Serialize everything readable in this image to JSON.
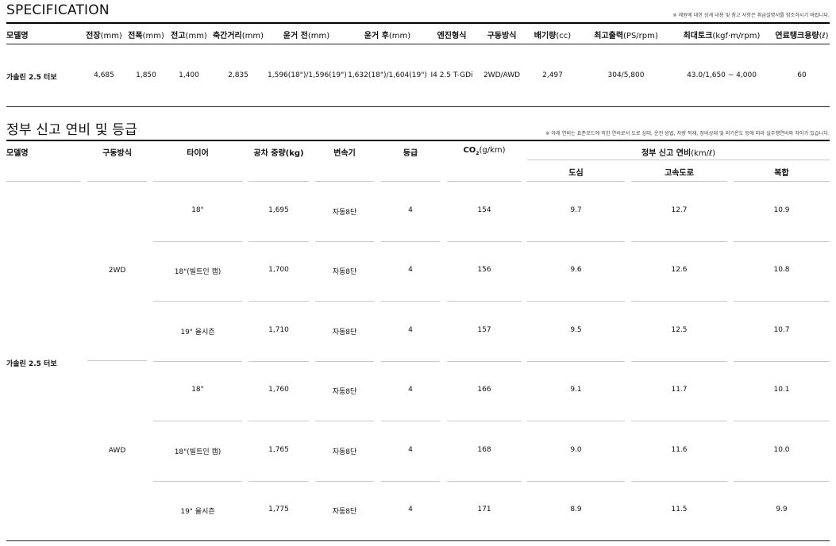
{
  "spec": {
    "title": "SPECIFICATION",
    "note": "※ 제원에 대한 상세 내용 및 참고 사항은 취급설명서를 참조하시기 바랍니다.",
    "headers": [
      {
        "label": "모델명",
        "unit": ""
      },
      {
        "label": "전장",
        "unit": "(mm)"
      },
      {
        "label": "전폭",
        "unit": "(mm)"
      },
      {
        "label": "전고",
        "unit": "(mm)"
      },
      {
        "label": "축간거리",
        "unit": "(mm)"
      },
      {
        "label": "윤거 전",
        "unit": "(mm)"
      },
      {
        "label": "윤거 후",
        "unit": "(mm)"
      },
      {
        "label": "엔진형식",
        "unit": ""
      },
      {
        "label": "구동방식",
        "unit": ""
      },
      {
        "label": "배기량",
        "unit": "(cc)"
      },
      {
        "label": "최고출력",
        "unit": "(PS/rpm)"
      },
      {
        "label": "최대토크",
        "unit": "(kgf·m/rpm)"
      },
      {
        "label": "연료탱크용량",
        "unit": "(ℓ)"
      }
    ],
    "row": [
      "가솔린 2.5 터보",
      "4,685",
      "1,850",
      "1,400",
      "2,835",
      "1,596(18\")/1,596(19\")",
      "1,632(18\")/1,604(19\")",
      "I4 2.5 T-GDi",
      "2WD/AWD",
      "2,497",
      "304/5,800",
      "43.0/1,650 ~ 4,000",
      "60"
    ]
  },
  "fuel": {
    "title": "정부 신고 연비 및 등급",
    "note": "※ 아래 연비는 표준모드에 의한 연비로서 도로 상태, 운전 방법, 차량 적재, 정비상태 및 외기온도 등에 따라 실주행연비와 차이가 있습니다.",
    "headers": {
      "model": "모델명",
      "drive": "구동방식",
      "tire": "타이어",
      "weight": "공차 중량(kg)",
      "trans": "변속기",
      "grade": "등급",
      "co2_main": "CO",
      "co2_sub": "2",
      "co2_unit": "(g/km)",
      "eff_main": "정부 신고 연비",
      "eff_unit": "(km/ℓ)",
      "city": "도심",
      "highway": "고속도로",
      "combined": "복합"
    },
    "model": "가솔린 2.5 터보",
    "groups": [
      "2WD",
      "AWD"
    ],
    "rows": [
      {
        "tire": "18\"",
        "weight": "1,695",
        "trans": "자동8단",
        "grade": "4",
        "co2": "154",
        "city": "9.7",
        "highway": "12.7",
        "combined": "10.9"
      },
      {
        "tire": "18\"(빌트인 캠)",
        "weight": "1,700",
        "trans": "자동8단",
        "grade": "4",
        "co2": "156",
        "city": "9.6",
        "highway": "12.6",
        "combined": "10.8"
      },
      {
        "tire": "19\" 올시즌",
        "weight": "1,710",
        "trans": "자동8단",
        "grade": "4",
        "co2": "157",
        "city": "9.5",
        "highway": "12.5",
        "combined": "10.7"
      },
      {
        "tire": "18\"",
        "weight": "1,760",
        "trans": "자동8단",
        "grade": "4",
        "co2": "166",
        "city": "9.1",
        "highway": "11.7",
        "combined": "10.1"
      },
      {
        "tire": "18\"(빌트인 캠)",
        "weight": "1,765",
        "trans": "자동8단",
        "grade": "4",
        "co2": "168",
        "city": "9.0",
        "highway": "11.6",
        "combined": "10.0"
      },
      {
        "tire": "19\" 올시즌",
        "weight": "1,775",
        "trans": "자동8단",
        "grade": "4",
        "co2": "171",
        "city": "8.9",
        "highway": "11.5",
        "combined": "9.9"
      }
    ]
  }
}
